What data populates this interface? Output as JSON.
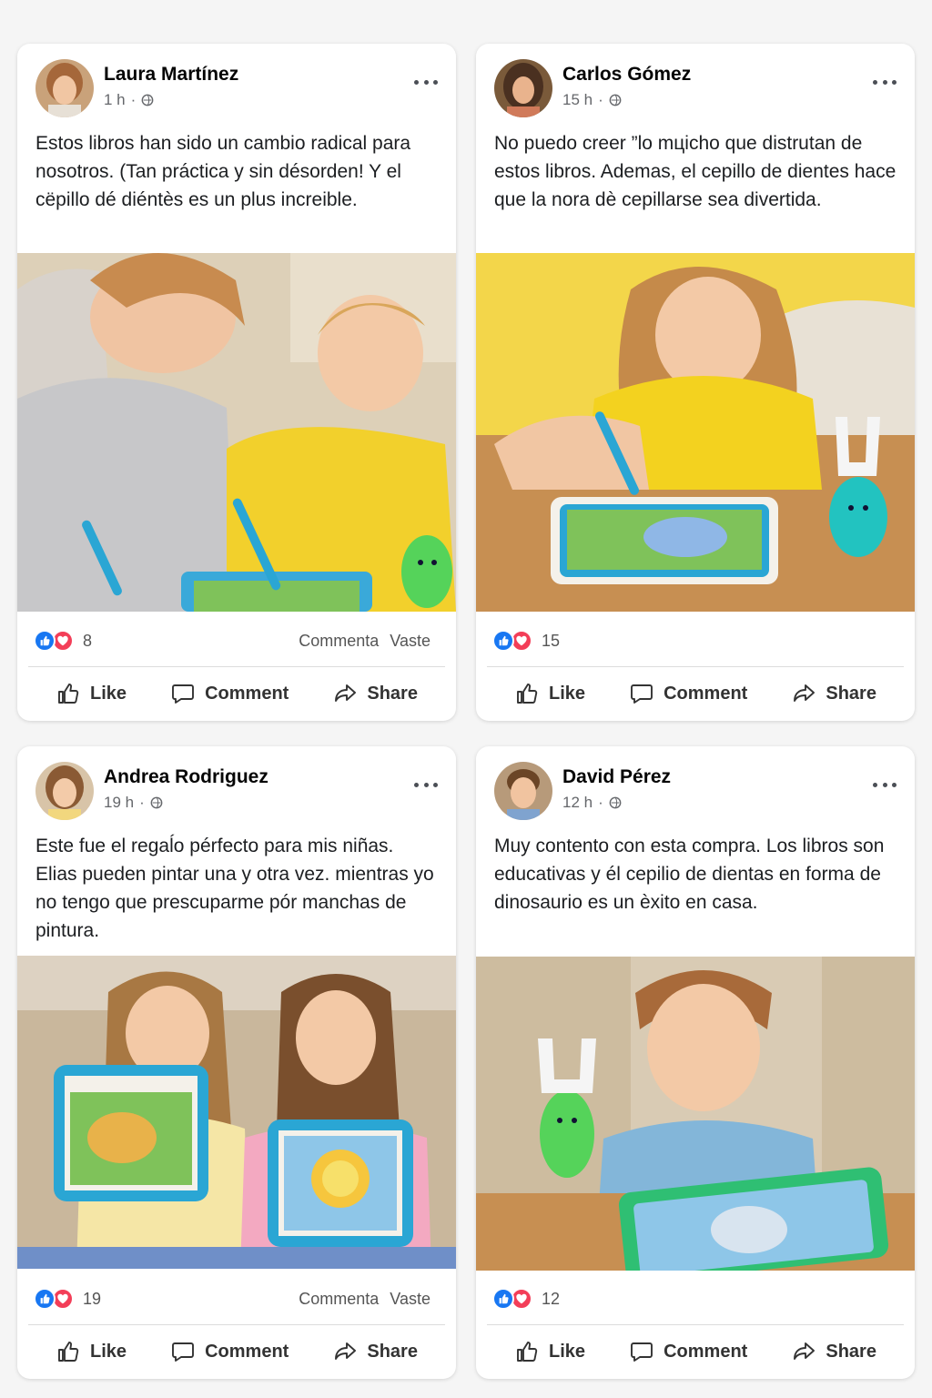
{
  "posts": [
    {
      "author": "Laura Martínez",
      "time": "1 h",
      "text": "Estos libros han sido un cambio radical para nosotros. (Tan práctica y sin désorden! Y el cëpillo dé diéntès es un plus increible.",
      "reaction_count": "8",
      "stat_comment": "Commenta",
      "stat_share": "Vaste",
      "actions": {
        "like": "Like",
        "comment": "Comment",
        "share": "Share"
      }
    },
    {
      "author": "Carlos Gómez",
      "time": "15 h",
      "text": "No puedo creer ”lo mцicho que distrutan de estos libros. Ademas, el cepillo de dientes hace que la nora dè cepillarse sea divertida.",
      "reaction_count": "15",
      "stat_comment": "",
      "stat_share": "",
      "actions": {
        "like": "Like",
        "comment": "Comment",
        "share": "Share"
      }
    },
    {
      "author": "Andrea Rodriguez",
      "time": "19 h",
      "text": "Este fue el regaĺo pérfecto para mis niñas. Elias pueden pintar una y otra vez. mientras yo no tengo que prescuparme pór manchas de pintura.",
      "reaction_count": "19",
      "stat_comment": "Commenta",
      "stat_share": "Vaste",
      "actions": {
        "like": "Like",
        "comment": "Comment",
        "share": "Share"
      }
    },
    {
      "author": "David Pérez",
      "time": "12 h",
      "text": "Muy contento con esta compra. Los libros son educativas y él cepilio de dientas en forma de dinosaurio es un èxito en casa.",
      "reaction_count": "12",
      "stat_comment": "",
      "stat_share": "",
      "actions": {
        "like": "Like",
        "comment": "Comment",
        "share": "Share"
      }
    }
  ],
  "colors": {
    "like": "#1877f2",
    "love": "#f33e58",
    "meta": "#65676b",
    "background": "#f5f5f5"
  },
  "icons": [
    "globe-icon",
    "more-icon",
    "like-reaction-icon",
    "love-reaction-icon",
    "thumbs-up-icon",
    "comment-icon",
    "share-icon"
  ]
}
